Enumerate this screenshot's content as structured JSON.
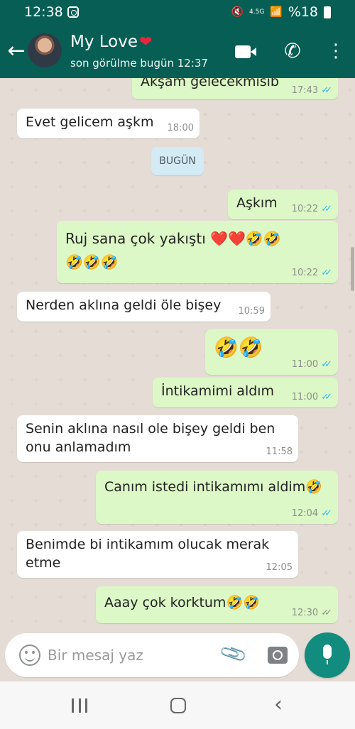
{
  "status": {
    "time": "12:38",
    "network": "4.5G",
    "battery": "%18"
  },
  "header": {
    "contact_name": "My Love",
    "last_seen": "son görülme bugün 12:37",
    "icons": [
      "back-arrow-icon",
      "avatar",
      "heart-icon",
      "video-call-icon",
      "phone-call-icon",
      "more-options-icon"
    ]
  },
  "chat": {
    "day_label": "BUGÜN",
    "messages": [
      {
        "dir": "out",
        "text": "Akşam gelecekmisib",
        "time": "17:43",
        "status": "read"
      },
      {
        "dir": "in",
        "text": "Evet gelicem aşkm",
        "time": "18:00"
      },
      {
        "dir": "out",
        "text": "Aşkım",
        "time": "10:22",
        "status": "read"
      },
      {
        "dir": "out",
        "text": "Ruj sana çok yakıştı ❤️❤️🤣🤣 🤣🤣🤣",
        "time": "10:22",
        "status": "read"
      },
      {
        "dir": "in",
        "text": "Nerden aklına geldi öle bişey",
        "time": "10:59"
      },
      {
        "dir": "out",
        "text": "🤣🤣",
        "time": "11:00",
        "status": "read"
      },
      {
        "dir": "out",
        "text": "İntikamimi aldım",
        "time": "11:00",
        "status": "read"
      },
      {
        "dir": "in",
        "text": "Senin aklına nasıl ole bişey geldi ben onu anlamadım",
        "time": "11:58"
      },
      {
        "dir": "out",
        "text": "Canım istedi intikamımı aldim🤣",
        "time": "12:04",
        "status": "read"
      },
      {
        "dir": "in",
        "text": "Benimde bi intikamım olucak merak etme",
        "time": "12:05"
      },
      {
        "dir": "out",
        "text": "Aaay çok korktum🤣🤣",
        "time": "12:30",
        "status": "delivered"
      }
    ]
  },
  "composer": {
    "placeholder": "Bir mesaj yaz"
  },
  "colors": {
    "header": "#075e54",
    "outgoing": "#dcf8c6",
    "incoming": "#ffffff",
    "accent": "#128c7e",
    "read_tick": "#34b7f1"
  }
}
